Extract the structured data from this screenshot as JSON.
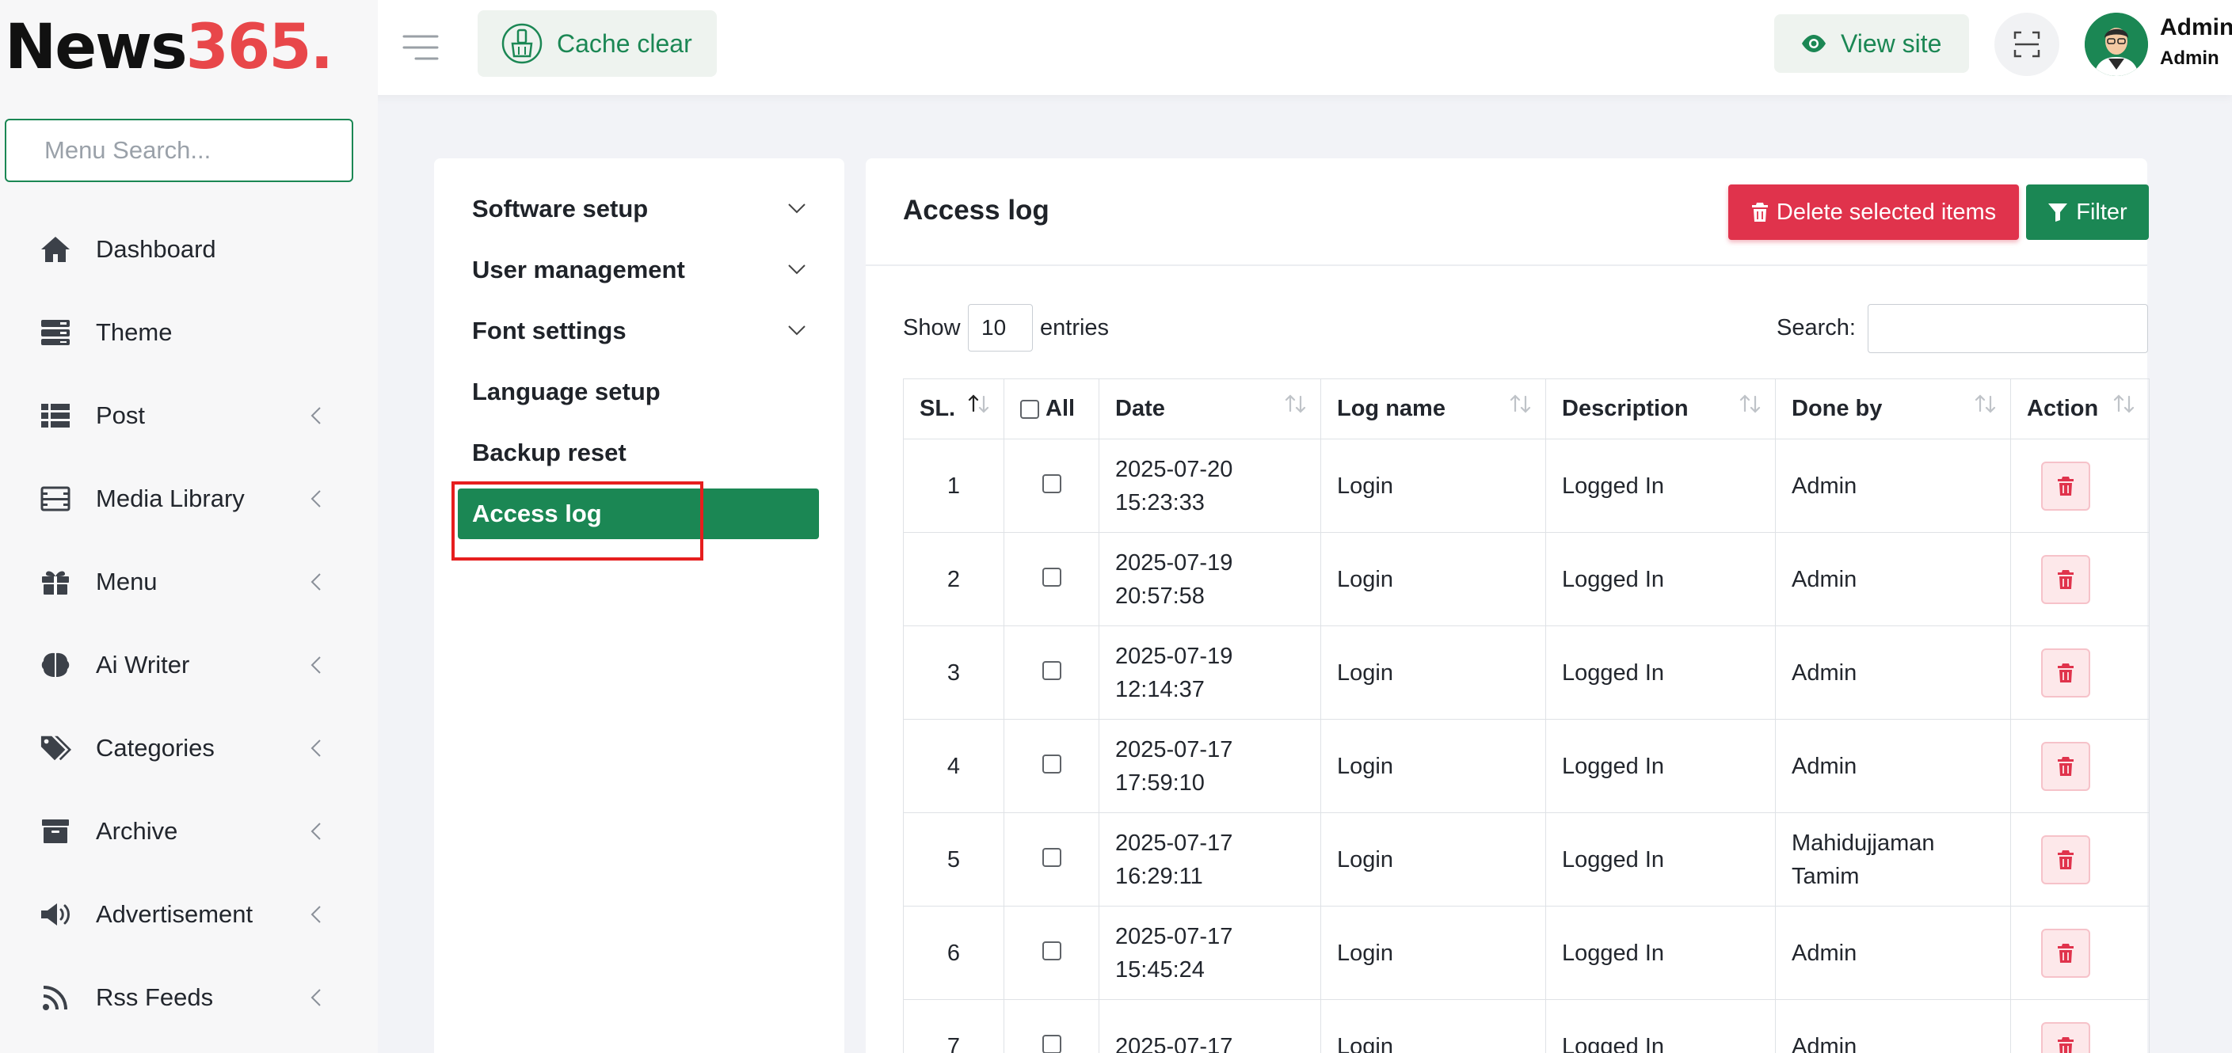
{
  "app": {
    "logo_main": "News",
    "logo_accent": "365.",
    "cache_clear": "Cache clear",
    "view_site": "View site",
    "user_name": "Admin",
    "user_role": "Admin"
  },
  "sidebar": {
    "search_placeholder": "Menu Search...",
    "items": [
      {
        "label": "Dashboard",
        "icon": "home-icon"
      },
      {
        "label": "Theme",
        "icon": "theme-icon"
      },
      {
        "label": "Post",
        "icon": "list-icon"
      },
      {
        "label": "Media Library",
        "icon": "film-icon"
      },
      {
        "label": "Menu",
        "icon": "gift-icon"
      },
      {
        "label": "Ai Writer",
        "icon": "brain-icon"
      },
      {
        "label": "Categories",
        "icon": "tags-icon"
      },
      {
        "label": "Archive",
        "icon": "archive-icon"
      },
      {
        "label": "Advertisement",
        "icon": "megaphone-icon"
      },
      {
        "label": "Rss Feeds",
        "icon": "rss-icon"
      }
    ]
  },
  "settings_menu": {
    "items": [
      {
        "label": "Software setup",
        "has_children": true
      },
      {
        "label": "User management",
        "has_children": true
      },
      {
        "label": "Font settings",
        "has_children": true
      },
      {
        "label": "Language setup",
        "has_children": false
      },
      {
        "label": "Backup reset",
        "has_children": false
      },
      {
        "label": "Access log",
        "has_children": false,
        "active": true
      }
    ]
  },
  "main": {
    "title": "Access log",
    "delete_button": "Delete selected items",
    "filter_button": "Filter",
    "show_label": "Show",
    "entries_value": "10",
    "entries_label": "entries",
    "search_label": "Search:",
    "search_value": ""
  },
  "table": {
    "columns": [
      "SL.",
      "All",
      "Date",
      "Log name",
      "Description",
      "Done by",
      "Action"
    ],
    "rows": [
      {
        "sl": "1",
        "date": "2025-07-20",
        "time": "15:23:33",
        "log_name": "Login",
        "description": "Logged In",
        "done_by": "Admin",
        "done_by_2": ""
      },
      {
        "sl": "2",
        "date": "2025-07-19",
        "time": "20:57:58",
        "log_name": "Login",
        "description": "Logged In",
        "done_by": "Admin",
        "done_by_2": ""
      },
      {
        "sl": "3",
        "date": "2025-07-19",
        "time": "12:14:37",
        "log_name": "Login",
        "description": "Logged In",
        "done_by": "Admin",
        "done_by_2": ""
      },
      {
        "sl": "4",
        "date": "2025-07-17",
        "time": "17:59:10",
        "log_name": "Login",
        "description": "Logged In",
        "done_by": "Admin",
        "done_by_2": ""
      },
      {
        "sl": "5",
        "date": "2025-07-17",
        "time": "16:29:11",
        "log_name": "Login",
        "description": "Logged In",
        "done_by": "Mahidujjaman",
        "done_by_2": "Tamim"
      },
      {
        "sl": "6",
        "date": "2025-07-17",
        "time": "15:45:24",
        "log_name": "Login",
        "description": "Logged In",
        "done_by": "Admin",
        "done_by_2": ""
      },
      {
        "sl": "7",
        "date": "2025-07-17",
        "time": "",
        "log_name": "Login",
        "description": "Logged In",
        "done_by": "Admin",
        "done_by_2": ""
      }
    ]
  },
  "colors": {
    "brand_green": "#1b8754",
    "logo_red": "#e8474a",
    "danger": "#e0334c",
    "highlight": "#e61e1e"
  }
}
